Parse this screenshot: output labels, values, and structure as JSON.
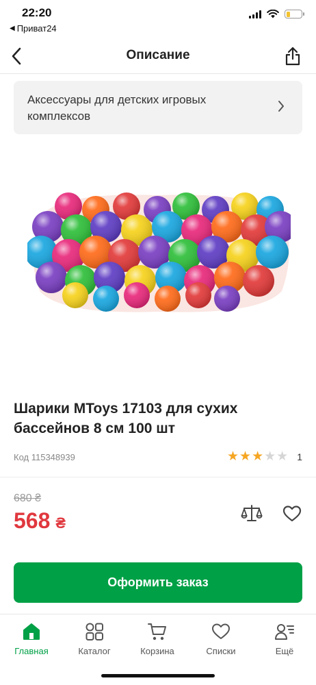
{
  "status_bar": {
    "time": "22:20",
    "back_app": "Приват24",
    "battery_level": 0.26
  },
  "header": {
    "title": "Описание",
    "back_icon": "chevron-left-icon",
    "share_icon": "share-icon"
  },
  "category": {
    "label": "Аксессуары для детских игровых комплексов",
    "icon": "chevron-right-icon"
  },
  "product": {
    "title": "Шарики MToys 17103 для сухих бассейнов 8 см 100 шт",
    "code": "Код 115348939",
    "rating": 3,
    "rating_max": 5,
    "reviews_count": "1",
    "old_price": "680 ₴",
    "price": "568",
    "currency": "₴",
    "image": "colorful-plastic-balls-in-net-bag"
  },
  "actions": {
    "compare_icon": "scales-icon",
    "wishlist_icon": "heart-icon",
    "order_label": "Оформить заказ"
  },
  "bottom_nav": {
    "items": [
      {
        "label": "Главная",
        "icon": "home-icon",
        "active": true
      },
      {
        "label": "Каталог",
        "icon": "catalog-grid-icon",
        "active": false
      },
      {
        "label": "Корзина",
        "icon": "cart-icon",
        "active": false
      },
      {
        "label": "Списки",
        "icon": "heart-icon",
        "active": false
      },
      {
        "label": "Ещё",
        "icon": "user-menu-icon",
        "active": false
      }
    ]
  },
  "colors": {
    "accent": "#00a046",
    "price": "#e0383e",
    "star": "#f5a623"
  }
}
